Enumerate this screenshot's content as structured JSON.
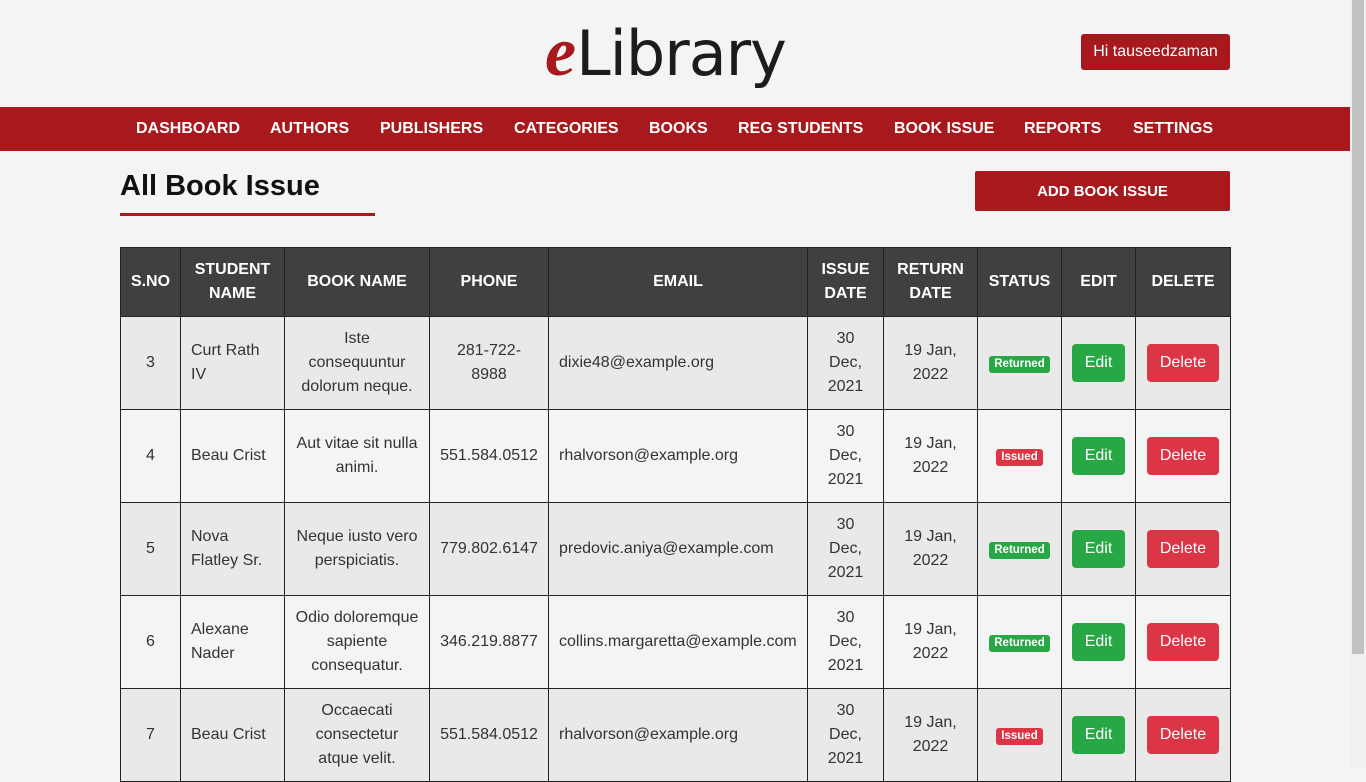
{
  "brand": {
    "logo_e": "e",
    "logo_rest": "Library",
    "accent": "#a8191d"
  },
  "header": {
    "greeting": "Hi tauseedzaman"
  },
  "nav": {
    "items": [
      "DASHBOARD",
      "AUTHORS",
      "PUBLISHERS",
      "CATEGORIES",
      "BOOKS",
      "REG STUDENTS",
      "BOOK ISSUE",
      "REPORTS",
      "SETTINGS"
    ]
  },
  "page": {
    "title": "All Book Issue",
    "add_label": "ADD BOOK ISSUE"
  },
  "table": {
    "headers": [
      "S.NO",
      "STUDENT NAME",
      "BOOK NAME",
      "PHONE",
      "EMAIL",
      "ISSUE DATE",
      "RETURN DATE",
      "STATUS",
      "EDIT",
      "DELETE"
    ],
    "edit_label": "Edit",
    "delete_label": "Delete",
    "rows": [
      {
        "sno": "3",
        "student": "Curt Rath IV",
        "book": "Iste consequuntur dolorum neque.",
        "phone": "281-722-8988",
        "email": "dixie48@example.org",
        "issue": "30 Dec, 2021",
        "return": "19 Jan, 2022",
        "status": "Returned"
      },
      {
        "sno": "4",
        "student": "Beau Crist",
        "book": "Aut vitae sit nulla animi.",
        "phone": "551.584.0512",
        "email": "rhalvorson@example.org",
        "issue": "30 Dec, 2021",
        "return": "19 Jan, 2022",
        "status": "Issued"
      },
      {
        "sno": "5",
        "student": "Nova Flatley Sr.",
        "book": "Neque iusto vero perspiciatis.",
        "phone": "779.802.6147",
        "email": "predovic.aniya@example.com",
        "issue": "30 Dec, 2021",
        "return": "19 Jan, 2022",
        "status": "Returned"
      },
      {
        "sno": "6",
        "student": "Alexane Nader",
        "book": "Odio doloremque sapiente consequatur.",
        "phone": "346.219.8877",
        "email": "collins.margaretta@example.com",
        "issue": "30 Dec, 2021",
        "return": "19 Jan, 2022",
        "status": "Returned"
      },
      {
        "sno": "7",
        "student": "Beau Crist",
        "book": "Occaecati consectetur atque velit.",
        "phone": "551.584.0512",
        "email": "rhalvorson@example.org",
        "issue": "30 Dec, 2021",
        "return": "19 Jan, 2022",
        "status": "Issued"
      }
    ]
  }
}
